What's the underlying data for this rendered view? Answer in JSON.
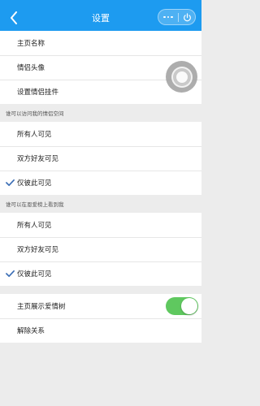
{
  "colors": {
    "accent": "#1d9bf0",
    "toggle_on": "#5fc85f",
    "check": "#3a6db5",
    "background": "#ececec"
  },
  "nav": {
    "title": "设置",
    "back_icon": "chevron-left-icon",
    "more_icon": "more-dots-icon",
    "close_icon": "power-icon"
  },
  "profile_group": {
    "items": [
      {
        "label": "主页名称"
      },
      {
        "label": "情侣头像"
      },
      {
        "label": "设置情侣挂件"
      }
    ]
  },
  "visit_section": {
    "header": "谁可以访问我的情侣空间",
    "options": [
      {
        "label": "所有人可见",
        "checked": false
      },
      {
        "label": "双方好友可见",
        "checked": false
      },
      {
        "label": "仅彼此可见",
        "checked": true
      }
    ]
  },
  "ranking_section": {
    "header": "谁可以在恩爱榜上看到我",
    "options": [
      {
        "label": "所有人可见",
        "checked": false
      },
      {
        "label": "双方好友可见",
        "checked": false
      },
      {
        "label": "仅彼此可见",
        "checked": true
      }
    ]
  },
  "misc_group": {
    "love_tree": {
      "label": "主页展示爱情树",
      "enabled": true
    },
    "unbind": {
      "label": "解除关系"
    }
  },
  "floating_button": {
    "icon": "assistive-touch-icon"
  }
}
